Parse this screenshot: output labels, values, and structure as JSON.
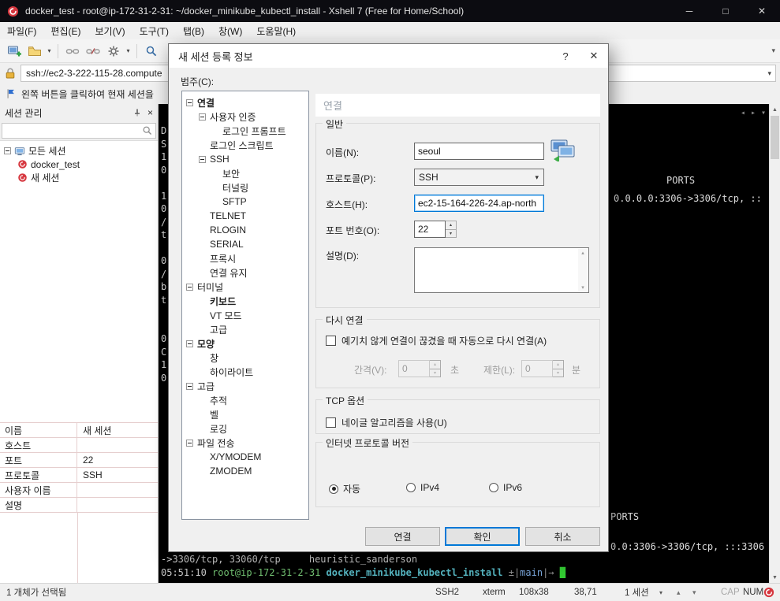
{
  "colors": {
    "accent": "#0078d7",
    "titlebar": "#0c0c11",
    "logo_red": "#d6373f",
    "terminal_bg": "#000000"
  },
  "window": {
    "title": "docker_test - root@ip-172-31-2-31: ~/docker_minikube_kubectl_install - Xshell 7 (Free for Home/School)",
    "minimize_glyph": "─",
    "maximize_glyph": "□",
    "close_glyph": "✕"
  },
  "menubar": [
    "파일(F)",
    "편집(E)",
    "보기(V)",
    "도구(T)",
    "탭(B)",
    "창(W)",
    "도움말(H)"
  ],
  "addressbar": {
    "value": "ssh://ec2-3-222-115-28.compute"
  },
  "infobar": {
    "text": "왼쪽 버튼을 클릭하여 현재 세션을"
  },
  "sidebar": {
    "title": "세션 관리",
    "close_glyph": "×",
    "tree": [
      {
        "label": "모든 세션",
        "level": 0,
        "icon": "sessions-root",
        "expander": true
      },
      {
        "label": "docker_test",
        "level": 1,
        "icon": "session"
      },
      {
        "label": "새 세션",
        "level": 1,
        "icon": "session"
      }
    ],
    "properties": [
      {
        "label": "이름",
        "value": "새 세션"
      },
      {
        "label": "호스트",
        "value": ""
      },
      {
        "label": "포트",
        "value": "22"
      },
      {
        "label": "프로토콜",
        "value": "SSH"
      },
      {
        "label": "사용자 이름",
        "value": ""
      },
      {
        "label": "설명",
        "value": ""
      }
    ]
  },
  "dialog": {
    "title": "새 세션 등록 정보",
    "help_glyph": "?",
    "close_glyph": "✕",
    "category_label": "범주(C):",
    "section_header": "연결",
    "tree": [
      {
        "label": "연결",
        "level": 0,
        "expander": true,
        "bold": true
      },
      {
        "label": "사용자 인증",
        "level": 1,
        "expander": true
      },
      {
        "label": "로그인 프롬프트",
        "level": 2
      },
      {
        "label": "로그인 스크립트",
        "level": 1
      },
      {
        "label": "SSH",
        "level": 1,
        "expander": true
      },
      {
        "label": "보안",
        "level": 2
      },
      {
        "label": "터널링",
        "level": 2
      },
      {
        "label": "SFTP",
        "level": 2
      },
      {
        "label": "TELNET",
        "level": 1
      },
      {
        "label": "RLOGIN",
        "level": 1
      },
      {
        "label": "SERIAL",
        "level": 1
      },
      {
        "label": "프록시",
        "level": 1
      },
      {
        "label": "연결 유지",
        "level": 1
      },
      {
        "label": "터미널",
        "level": 0,
        "expander": true
      },
      {
        "label": "키보드",
        "level": 1,
        "bold": true
      },
      {
        "label": "VT 모드",
        "level": 1
      },
      {
        "label": "고급",
        "level": 1
      },
      {
        "label": "모양",
        "level": 0,
        "expander": true,
        "bold": true
      },
      {
        "label": "창",
        "level": 1
      },
      {
        "label": "하이라이트",
        "level": 1
      },
      {
        "label": "고급",
        "level": 0,
        "expander": true
      },
      {
        "label": "추적",
        "level": 1
      },
      {
        "label": "벨",
        "level": 1
      },
      {
        "label": "로깅",
        "level": 1
      },
      {
        "label": "파일 전송",
        "level": 0,
        "expander": true
      },
      {
        "label": "X/YMODEM",
        "level": 1
      },
      {
        "label": "ZMODEM",
        "level": 1
      }
    ],
    "general": {
      "title": "일반",
      "name_label": "이름(N):",
      "name_value": "seoul",
      "protocol_label": "프로토콜(P):",
      "protocol_value": "SSH",
      "host_label": "호스트(H):",
      "host_value": "ec2-15-164-226-24.ap-north",
      "port_label": "포트 번호(O):",
      "port_value": "22",
      "description_label": "설명(D):"
    },
    "reconnect": {
      "title": "다시 연결",
      "auto_reconnect_label": "예기치 않게 연결이 끊겼을 때 자동으로 다시 연결(A)",
      "interval_label": "간격(V):",
      "interval_value": "0",
      "interval_unit": "초",
      "limit_label": "제한(L):",
      "limit_value": "0",
      "limit_unit": "분"
    },
    "tcp": {
      "title": "TCP 옵션",
      "nagle_label": "네이글 알고리즘을 사용(U)"
    },
    "ip_version": {
      "title": "인터넷 프로토콜 버전",
      "options": [
        {
          "label": "자동",
          "selected": true
        },
        {
          "label": "IPv4",
          "selected": false
        },
        {
          "label": "IPv6",
          "selected": false
        }
      ]
    },
    "buttons": {
      "connect": "연결",
      "ok": "확인",
      "cancel": "취소"
    }
  },
  "terminal": {
    "left_column": "D\nS\n1\n0\n\n1\n0\n/\nt\n\n0\n/\nb\nt\n\n\n0\nC\n1\n0",
    "fragment_ports_top": "PORTS",
    "fragment_line_top": "0.0.0.0:3306->3306/tcp, ::",
    "fragment_ports_bottom": "PORTS",
    "fragment_line_bottom": "0.0:3306->3306/tcp, :::3306",
    "line_wrap": "->3306/tcp, 33060/tcp     heuristic_sanderson",
    "prompt": [
      {
        "text": "05:51:10 ",
        "color": "#c9c9c9"
      },
      {
        "text": "root@ip-172-31-2-31 ",
        "color": "#72c272"
      },
      {
        "text": "docker_minikube_kubectl_install ",
        "color": "#56b6c2",
        "bold": true
      },
      {
        "text": "±|",
        "color": "#8f8f8f"
      },
      {
        "text": "main",
        "color": "#7aa6da"
      },
      {
        "text": "|→ ",
        "color": "#8f8f8f"
      },
      {
        "text": "█",
        "color": "#33cc33"
      }
    ]
  },
  "statusbar": {
    "selection": "1 개체가 선택됨",
    "protocol": "SSH2",
    "term_type": "xterm",
    "size": "108x38",
    "cursor": "38,71",
    "sessions": "1 세션",
    "cap": "CAP",
    "num": "NUM"
  }
}
